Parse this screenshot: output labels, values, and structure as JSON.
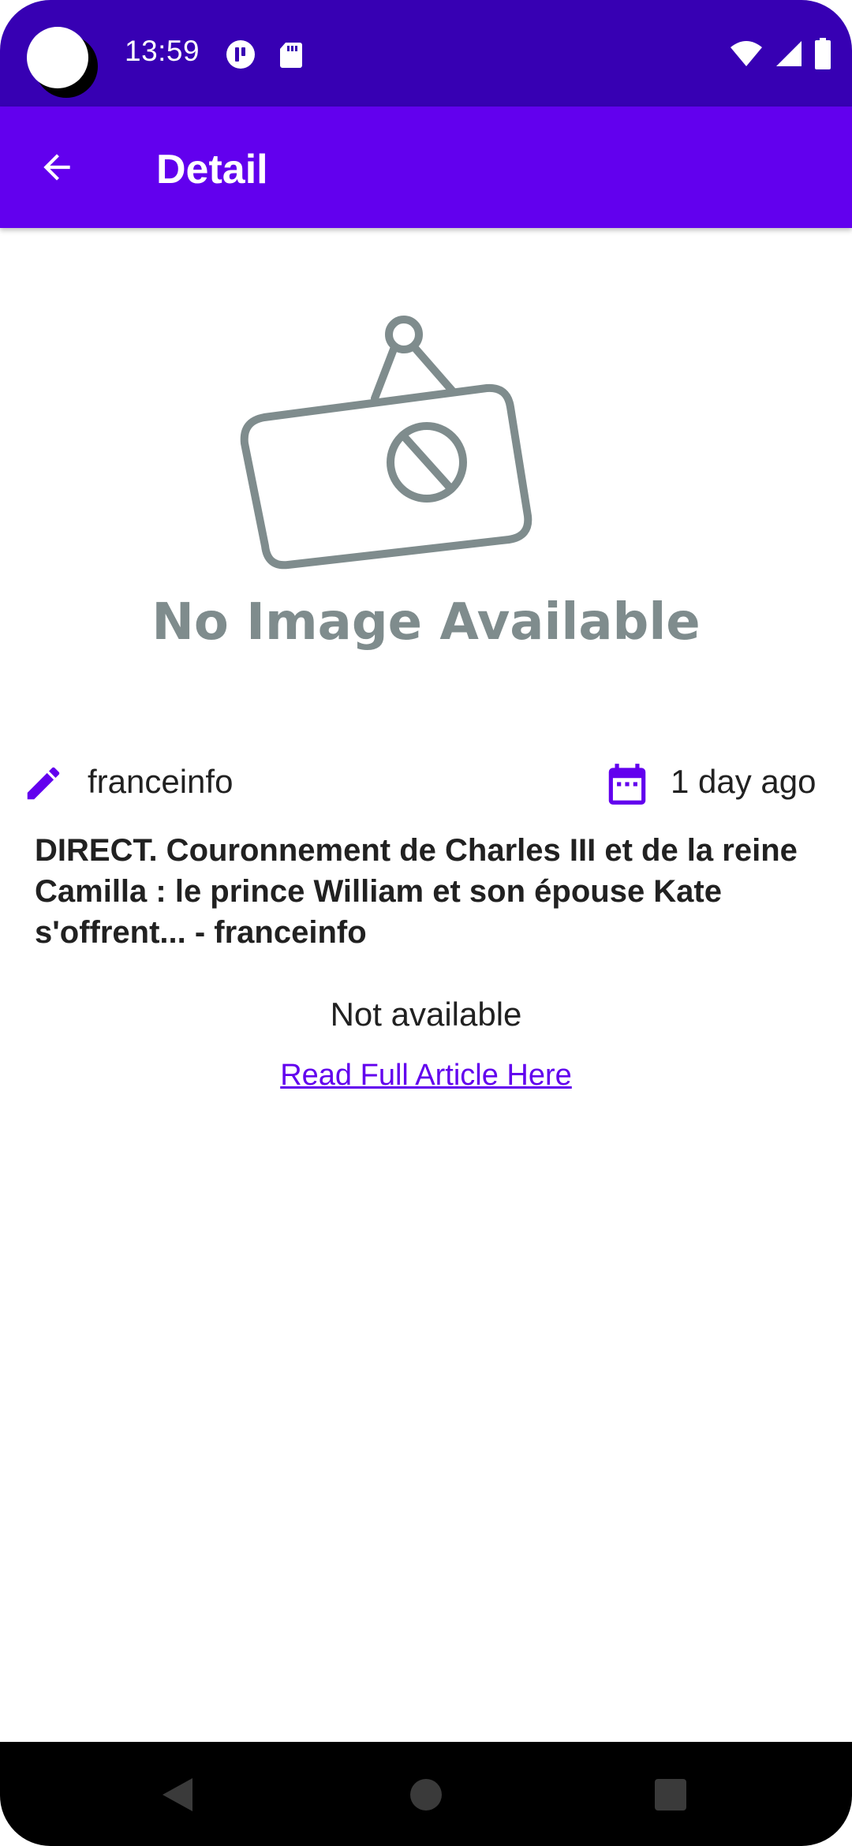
{
  "status_bar": {
    "time": "13:59",
    "left_icons": [
      "app-notification-icon",
      "sd-card-icon"
    ],
    "right_icons": [
      "wifi-icon",
      "cell-signal-icon",
      "battery-icon"
    ]
  },
  "app_bar": {
    "back_icon": "arrow-back-icon",
    "title": "Detail",
    "color": "#6200ee"
  },
  "article": {
    "image_placeholder_text": "No Image Available",
    "author_icon": "pencil-icon",
    "author": "franceinfo",
    "date_icon": "calendar-icon",
    "published": "1 day ago",
    "title": "DIRECT. Couronnement de Charles III et de la reine Camilla : le prince William et son épouse Kate s'offrent... - franceinfo",
    "description": "Not available",
    "link_label": "Read Full Article Here",
    "accent_color": "#6200ee"
  },
  "navigation_bar": {
    "buttons": [
      "back-triangle-icon",
      "home-circle-icon",
      "recents-square-icon"
    ]
  }
}
